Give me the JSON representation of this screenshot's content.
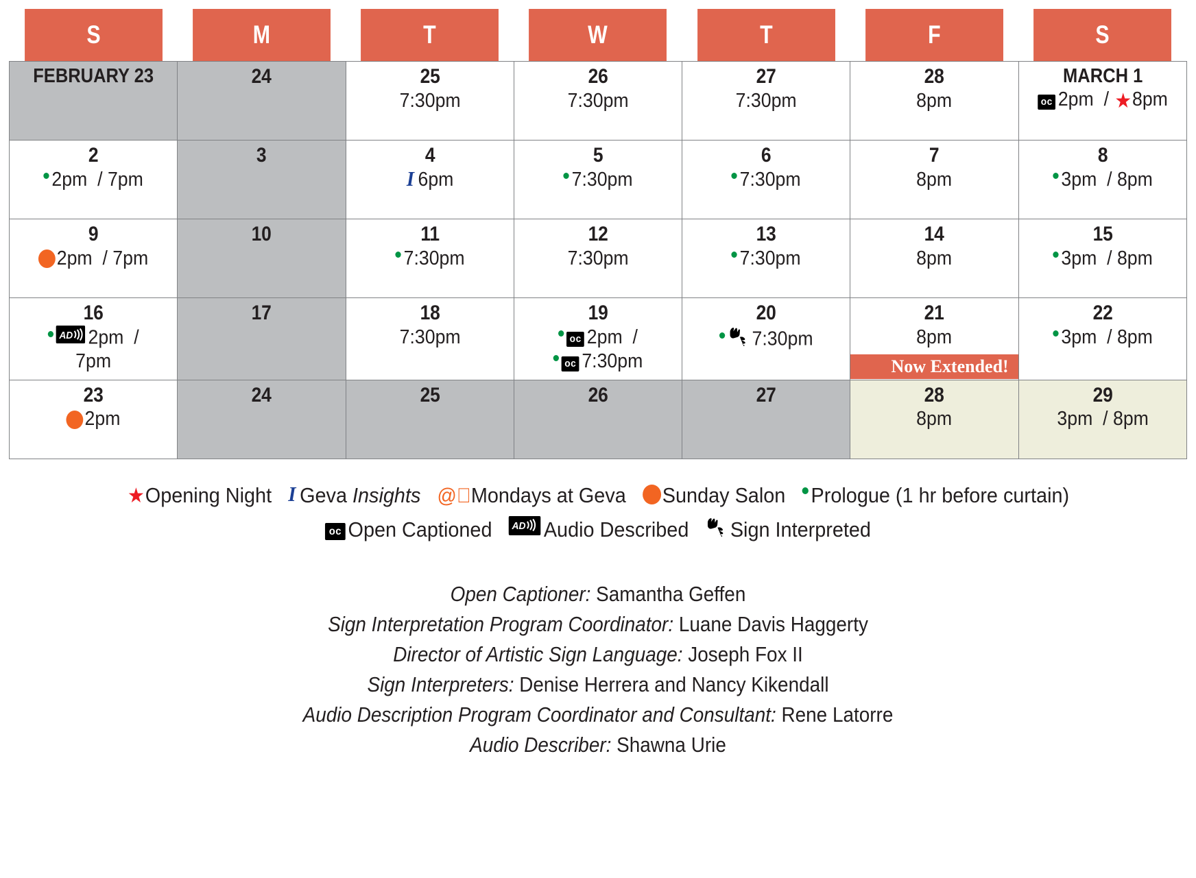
{
  "calendar": {
    "weekday_headers": [
      "S",
      "M",
      "T",
      "W",
      "T",
      "F",
      "S"
    ],
    "extended_banner": "Now Extended!",
    "weeks": [
      [
        {
          "day": "FEBRUARY 23",
          "long": true,
          "state": "dim",
          "times": []
        },
        {
          "day": "24",
          "state": "dim",
          "times": []
        },
        {
          "day": "25",
          "state": "normal",
          "times": [
            {
              "text": "7:30pm"
            }
          ]
        },
        {
          "day": "26",
          "state": "normal",
          "times": [
            {
              "text": "7:30pm"
            }
          ]
        },
        {
          "day": "27",
          "state": "normal",
          "times": [
            {
              "text": "7:30pm"
            }
          ]
        },
        {
          "day": "28",
          "state": "normal",
          "times": [
            {
              "text": "8pm"
            }
          ]
        },
        {
          "day": "MARCH 1",
          "long": true,
          "state": "normal",
          "times": [
            {
              "marks": [
                "oc"
              ],
              "text": "2pm",
              "sep": "/",
              "after_marks": [
                "star"
              ],
              "text2": "8pm"
            }
          ]
        }
      ],
      [
        {
          "day": "2",
          "state": "normal",
          "times": [
            {
              "marks": [
                "prologue"
              ],
              "text": "2pm",
              "sep": "/",
              "text2": "7pm"
            }
          ]
        },
        {
          "day": "3",
          "state": "dim",
          "times": []
        },
        {
          "day": "4",
          "state": "normal",
          "times": [
            {
              "marks": [
                "insights"
              ],
              "text": "6pm"
            }
          ]
        },
        {
          "day": "5",
          "state": "normal",
          "times": [
            {
              "marks": [
                "prologue"
              ],
              "text": "7:30pm"
            }
          ]
        },
        {
          "day": "6",
          "state": "normal",
          "times": [
            {
              "marks": [
                "prologue"
              ],
              "text": "7:30pm"
            }
          ]
        },
        {
          "day": "7",
          "state": "normal",
          "times": [
            {
              "text": "8pm"
            }
          ]
        },
        {
          "day": "8",
          "state": "normal",
          "times": [
            {
              "marks": [
                "prologue"
              ],
              "text": "3pm",
              "sep": "/",
              "text2": "8pm"
            }
          ]
        }
      ],
      [
        {
          "day": "9",
          "state": "normal",
          "times": [
            {
              "marks": [
                "salon"
              ],
              "text": "2pm",
              "sep": "/",
              "text2": "7pm"
            }
          ]
        },
        {
          "day": "10",
          "state": "dim",
          "times": []
        },
        {
          "day": "11",
          "state": "normal",
          "times": [
            {
              "marks": [
                "prologue"
              ],
              "text": "7:30pm"
            }
          ]
        },
        {
          "day": "12",
          "state": "normal",
          "times": [
            {
              "text": "7:30pm"
            }
          ]
        },
        {
          "day": "13",
          "state": "normal",
          "times": [
            {
              "marks": [
                "prologue"
              ],
              "text": "7:30pm"
            }
          ]
        },
        {
          "day": "14",
          "state": "normal",
          "times": [
            {
              "text": "8pm"
            }
          ]
        },
        {
          "day": "15",
          "state": "normal",
          "times": [
            {
              "marks": [
                "prologue"
              ],
              "text": "3pm",
              "sep": "/",
              "text2": "8pm"
            }
          ]
        }
      ],
      [
        {
          "day": "16",
          "state": "normal",
          "times": [
            {
              "marks": [
                "prologue",
                "ad"
              ],
              "text": "2pm",
              "sep": "/"
            },
            {
              "text": "7pm"
            }
          ]
        },
        {
          "day": "17",
          "state": "dim",
          "times": []
        },
        {
          "day": "18",
          "state": "normal",
          "times": [
            {
              "text": "7:30pm"
            }
          ]
        },
        {
          "day": "19",
          "state": "normal",
          "times": [
            {
              "marks": [
                "prologue",
                "oc"
              ],
              "text": "2pm",
              "sep": "/"
            },
            {
              "marks": [
                "prologue",
                "oc"
              ],
              "text": "7:30pm"
            }
          ]
        },
        {
          "day": "20",
          "state": "normal",
          "times": [
            {
              "marks": [
                "prologue",
                "sign"
              ],
              "text": "7:30pm"
            }
          ]
        },
        {
          "day": "21",
          "state": "normal",
          "times": [
            {
              "text": "8pm"
            }
          ]
        },
        {
          "day": "22",
          "state": "normal",
          "times": [
            {
              "marks": [
                "prologue"
              ],
              "text": "3pm",
              "sep": "/",
              "text2": "8pm"
            }
          ]
        }
      ],
      [
        {
          "day": "23",
          "state": "normal",
          "times": [
            {
              "marks": [
                "salon"
              ],
              "text": "2pm"
            }
          ]
        },
        {
          "day": "24",
          "state": "dim",
          "times": []
        },
        {
          "day": "25",
          "state": "dim",
          "times": []
        },
        {
          "day": "26",
          "state": "dim",
          "times": []
        },
        {
          "day": "27",
          "state": "dim",
          "times": []
        },
        {
          "day": "28",
          "state": "extended",
          "banner": true,
          "times": [
            {
              "text": "8pm"
            }
          ]
        },
        {
          "day": "29",
          "state": "extended",
          "times": [
            {
              "text": "3pm",
              "sep": "/",
              "text2": "8pm"
            }
          ]
        }
      ]
    ]
  },
  "legend": {
    "row1": [
      {
        "icon": "star",
        "label": "Opening Night"
      },
      {
        "icon": "insights",
        "label": "Geva ",
        "label_em": "Insights"
      },
      {
        "icon": "at",
        "label": "Mondays at Geva"
      },
      {
        "icon": "salon",
        "label": "Sunday Salon"
      },
      {
        "icon": "prologue",
        "label": "Prologue (1 hr before curtain)"
      }
    ],
    "row2": [
      {
        "icon": "oc",
        "label": "Open Captioned"
      },
      {
        "icon": "ad",
        "label": "Audio Described"
      },
      {
        "icon": "sign",
        "label": "Sign Interpreted"
      }
    ]
  },
  "credits": [
    {
      "role": "Open Captioner:",
      "name": " Samantha Geffen"
    },
    {
      "role": "Sign Interpretation Program Coordinator:",
      "name": " Luane Davis Haggerty"
    },
    {
      "role": "Director of Artistic Sign Language:",
      "name": " Joseph Fox II"
    },
    {
      "role": "Sign Interpreters:",
      "name": " Denise Herrera and Nancy Kikendall"
    },
    {
      "role": "Audio Description Program Coordinator and Consultant:",
      "name": " Rene Latorre"
    },
    {
      "role": "Audio Describer:",
      "name": " Shawna Urie"
    }
  ],
  "colors": {
    "header_orange": "#e0654e",
    "dim_grey": "#bcbec0",
    "extended_cream": "#eeeedc",
    "prologue_green": "#009444",
    "salon_orange": "#f26522",
    "star_red": "#ed1c24",
    "insights_blue": "#1b3f94"
  }
}
